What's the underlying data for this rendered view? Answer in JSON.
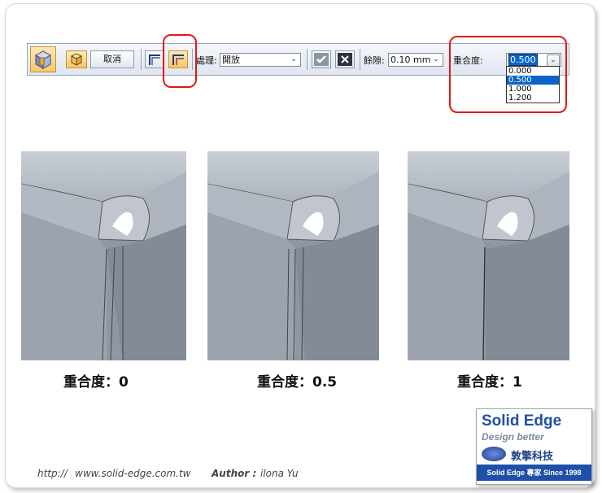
{
  "toolbar": {
    "cancel_label": "取消",
    "treatment_label": "處理:",
    "treatment_value": "開放",
    "gap_label": "餘隙:",
    "gap_value": "0.10 mm",
    "overlap_label": "重合度:",
    "overlap_value": "0.500",
    "overlap_options": [
      "0.000",
      "0.500",
      "1.000",
      "1.200"
    ],
    "overlap_selected": "0.500"
  },
  "captions": [
    "重合度：0",
    "重合度：0.5",
    "重合度：1"
  ],
  "footer": {
    "http_prefix": "http://",
    "url": "www.solid-edge.com.tw",
    "author_label": "Author :",
    "author_name": "ilona Yu"
  },
  "logo": {
    "title": "Solid Edge",
    "tagline": "Design better",
    "company": "敦擎科技",
    "since": "Solid Edge 專家 Since 1998"
  },
  "colors": {
    "accent_red": "#e31818",
    "selection_blue": "#0a64c8",
    "part_gray": "#9aa1ab",
    "logo_blue": "#1f4fa8"
  }
}
